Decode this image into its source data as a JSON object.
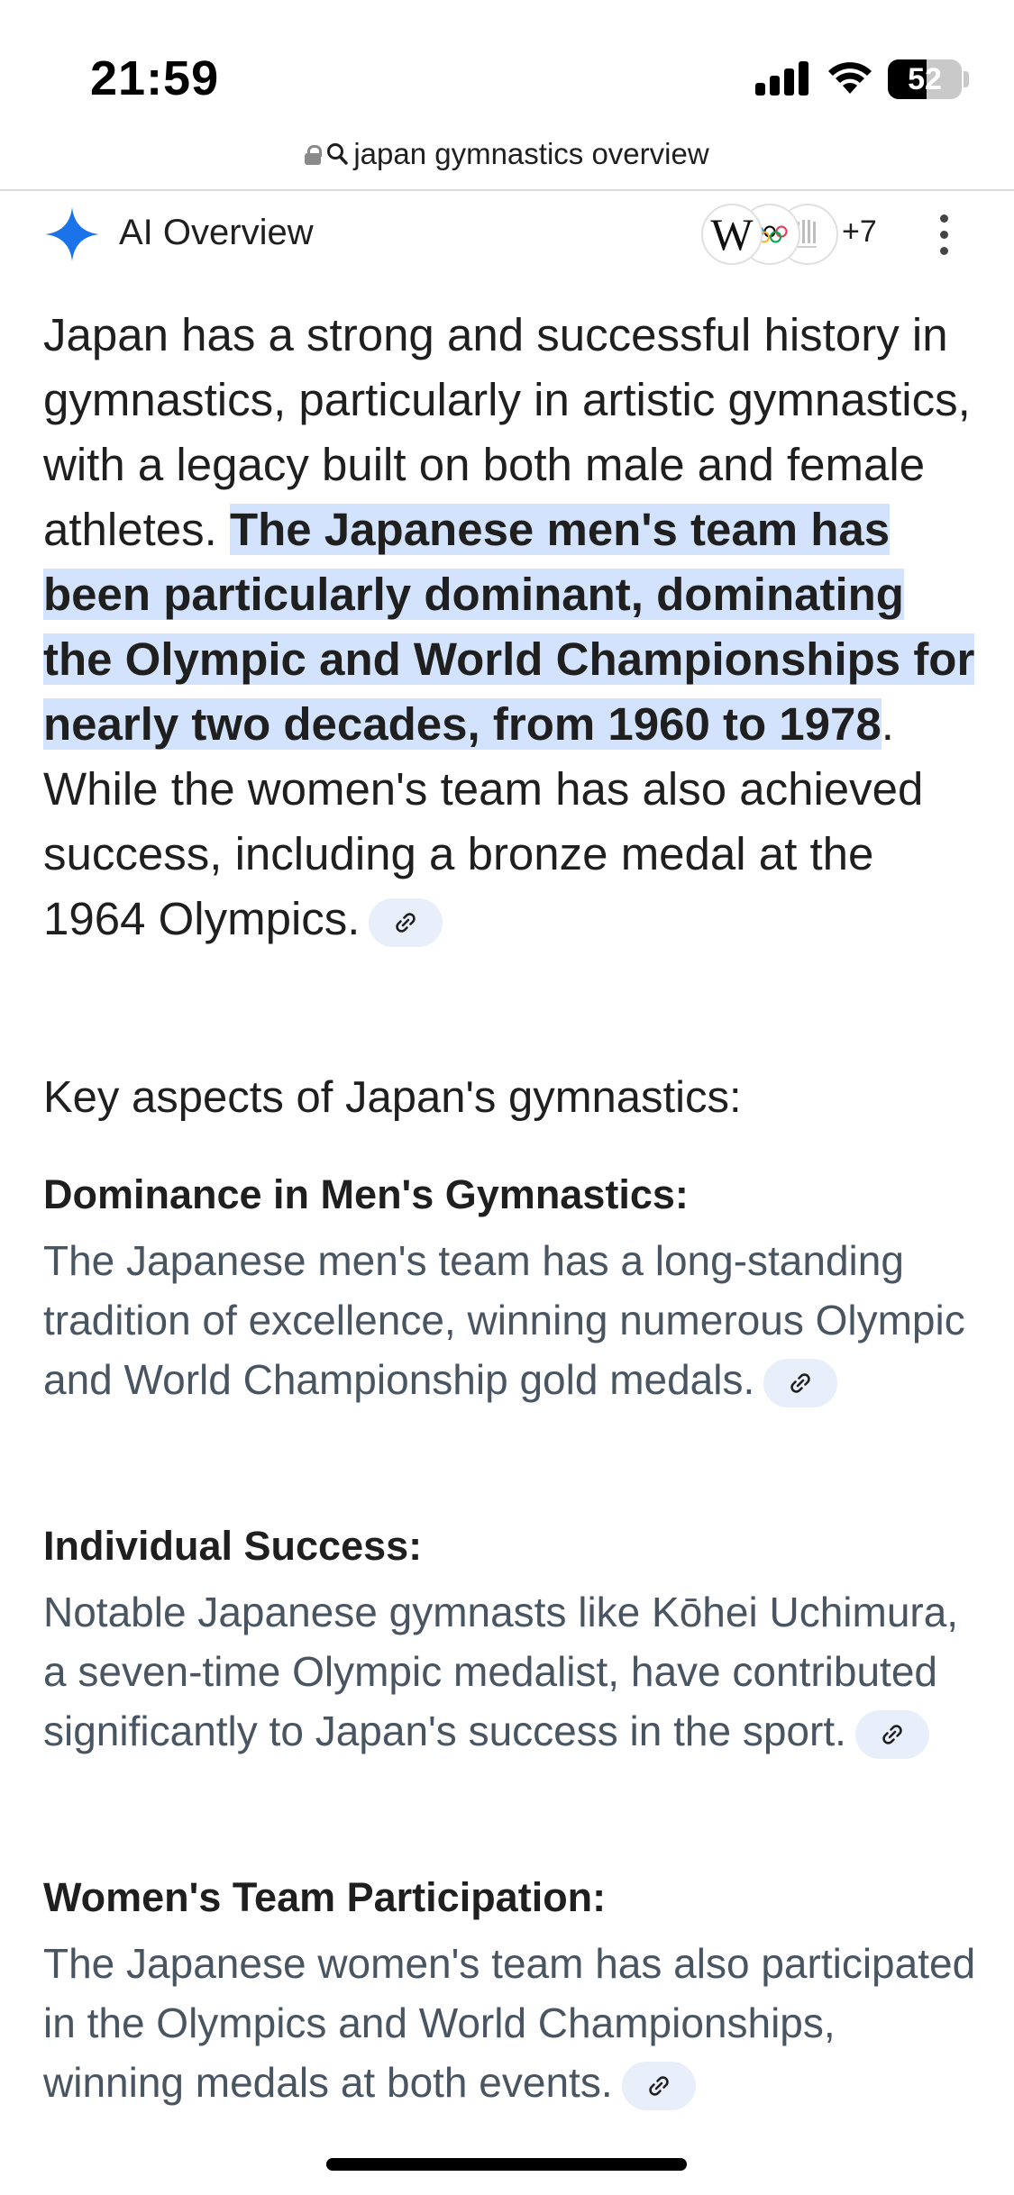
{
  "status_bar": {
    "time": "21:59",
    "battery_level": "52",
    "battery_fraction": 0.52,
    "signal_bars": 4,
    "wifi_icon": "wifi-icon"
  },
  "address_bar": {
    "url": "japan gymnastics overview",
    "icons": [
      "lock-icon",
      "search-icon"
    ]
  },
  "ai_overview": {
    "title": "AI Overview",
    "sources_more": "+7",
    "source_icons": [
      "wikipedia-icon",
      "olympic-rings-icon",
      "japan-gymnastics-icon"
    ],
    "accent_color": "#1a73e8",
    "highlight_color": "#d3e3fd"
  },
  "intro": {
    "text_before": "Japan has a strong and successful history in gymnastics, particularly in artistic gymnastics, with a legacy built on both male and female athletes. ",
    "highlight": "The Japanese men's team has been particularly dominant, dominating the Olympic and World Championships for nearly two decades, from 1960 to 1978",
    "text_after": ". While the women's team has also achieved success, including a bronze medal at the 1964 Olympics."
  },
  "key_aspects": {
    "heading": "Key aspects of Japan's gymnastics:",
    "items": [
      {
        "title": "Dominance in Men's Gymnastics:",
        "body": "The Japanese men's team has a long-standing tradition of excellence, winning numerous Olympic and World Championship gold medals."
      },
      {
        "title": "Individual Success:",
        "body": "Notable Japanese gymnasts like Kōhei Uchimura, a seven-time Olympic medalist, have contributed significantly to Japan's success in the sport."
      },
      {
        "title": "Women's Team Participation:",
        "body": "The Japanese women's team has also participated in the Olympics and World Championships, winning medals at both events."
      }
    ]
  }
}
